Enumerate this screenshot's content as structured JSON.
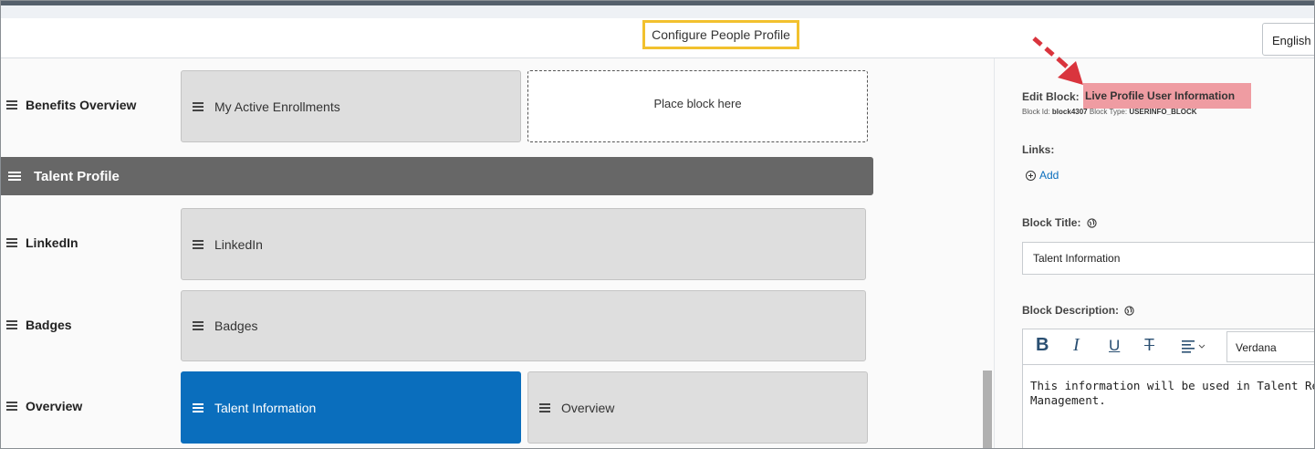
{
  "header": {
    "title": "Configure People Profile",
    "language": "English U"
  },
  "rows": [
    {
      "label": "Benefits Overview",
      "blocks": [
        "My Active Enrollments"
      ],
      "placeholder": "Place block here"
    },
    {
      "label": "LinkedIn",
      "blocks": [
        "LinkedIn"
      ]
    },
    {
      "label": "Badges",
      "blocks": [
        "Badges"
      ]
    },
    {
      "label": "Overview",
      "blocks": [
        "Talent Information",
        "Overview"
      ]
    }
  ],
  "section": {
    "title": "Talent Profile"
  },
  "panel": {
    "edit_block_label": "Edit Block:",
    "edit_block_value": "Live Profile User Information",
    "block_id_label": "Block Id:",
    "block_id": "block4307",
    "block_type_label": "Block Type:",
    "block_type": "USERINFO_BLOCK",
    "links_label": "Links:",
    "add_label": "Add",
    "block_title_label": "Block Title:",
    "block_title_value": "Talent Information",
    "block_description_label": "Block Description:",
    "font": "Verdana",
    "description_line1": "This information will be used in Talent Review and",
    "description_line2": "Management."
  },
  "toolbar": {
    "bold": "B",
    "italic": "I",
    "underline": "U",
    "strike": "T"
  },
  "colors": {
    "selected_block": "#0a6ebd",
    "section_bar": "#676767",
    "highlight": "#ef9ca2",
    "title_outline": "#f2c12e",
    "arrow": "#d9343d"
  }
}
